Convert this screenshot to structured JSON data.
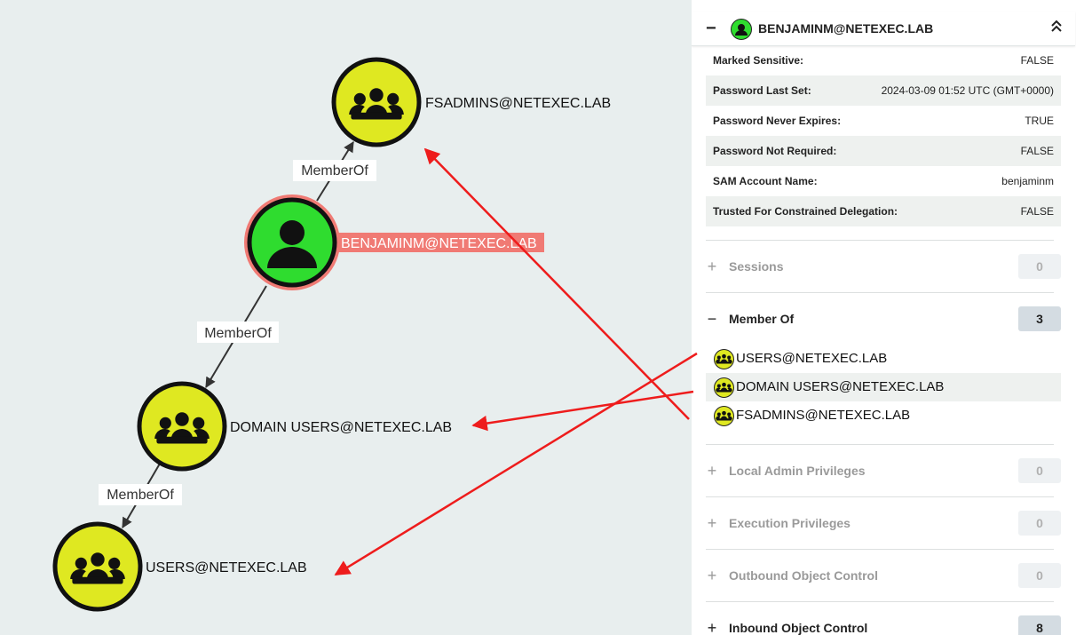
{
  "graph": {
    "nodes": [
      {
        "id": "fsadmins",
        "label": "FSADMINS@NETEXEC.LAB",
        "type": "group"
      },
      {
        "id": "benjaminm",
        "label": "BENJAMINM@NETEXEC.LAB",
        "type": "user",
        "selected": true
      },
      {
        "id": "domain_users",
        "label": "DOMAIN USERS@NETEXEC.LAB",
        "type": "group"
      },
      {
        "id": "users",
        "label": "USERS@NETEXEC.LAB",
        "type": "group"
      }
    ],
    "edges": [
      {
        "from": "benjaminm",
        "to": "fsadmins",
        "label": "MemberOf"
      },
      {
        "from": "benjaminm",
        "to": "domain_users",
        "label": "MemberOf"
      },
      {
        "from": "domain_users",
        "to": "users",
        "label": "MemberOf"
      }
    ],
    "colors": {
      "group": "#dfe821",
      "user": "#2fdc2f",
      "selected_ring": "#f07a74",
      "annotation_arrow": "#ee1c1c"
    }
  },
  "panel": {
    "header": {
      "title": "BENJAMINM@NETEXEC.LAB",
      "toggle": "−",
      "collapse_icon": "chevron-double-up-icon"
    },
    "properties": [
      {
        "key": "Marked Sensitive:",
        "value": "FALSE"
      },
      {
        "key": "Password Last Set:",
        "value": "2024-03-09 01:52 UTC (GMT+0000)"
      },
      {
        "key": "Password Never Expires:",
        "value": "TRUE"
      },
      {
        "key": "Password Not Required:",
        "value": "FALSE"
      },
      {
        "key": "SAM Account Name:",
        "value": "benjaminm"
      },
      {
        "key": "Trusted For Constrained Delegation:",
        "value": "FALSE"
      }
    ],
    "sections": [
      {
        "title": "Sessions",
        "toggle": "+",
        "count": "0"
      },
      {
        "title": "Member Of",
        "toggle": "−",
        "count": "3",
        "active": true
      },
      {
        "title": "Local Admin Privileges",
        "toggle": "+",
        "count": "0"
      },
      {
        "title": "Execution Privileges",
        "toggle": "+",
        "count": "0"
      },
      {
        "title": "Outbound Object Control",
        "toggle": "+",
        "count": "0"
      },
      {
        "title": "Inbound Object Control",
        "toggle": "+",
        "count": "8",
        "active": true
      }
    ],
    "member_of": [
      {
        "label": "USERS@NETEXEC.LAB"
      },
      {
        "label": "DOMAIN USERS@NETEXEC.LAB"
      },
      {
        "label": "FSADMINS@NETEXEC.LAB"
      }
    ]
  }
}
